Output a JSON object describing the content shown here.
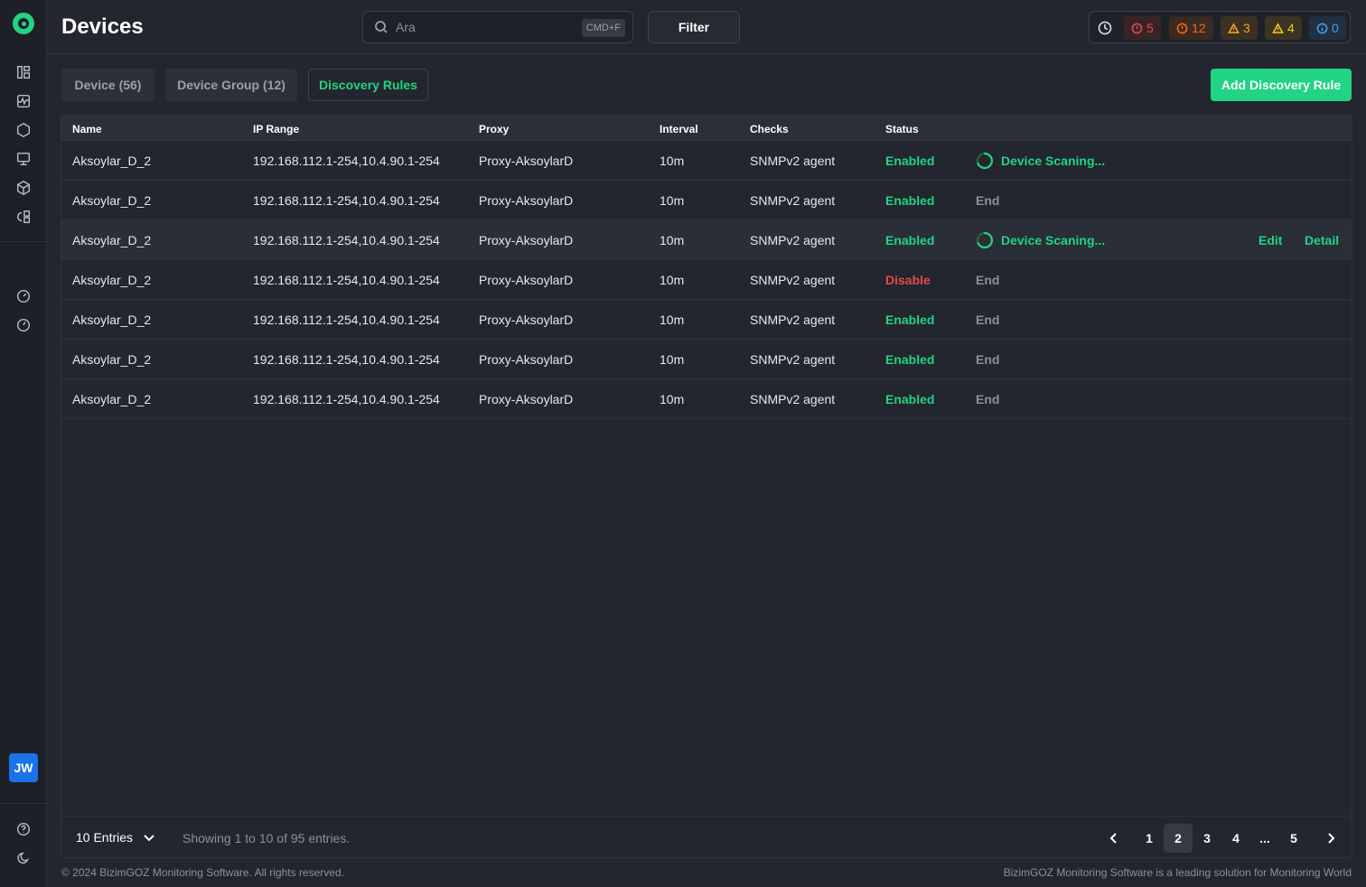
{
  "header": {
    "title": "Devices",
    "search_placeholder": "Ara",
    "search_shortcut": "CMD+F",
    "filter_label": "Filter",
    "alerts": [
      {
        "count": "5",
        "color": "#e5484d",
        "bg": "#3a2327",
        "icon": "error-circle-icon"
      },
      {
        "count": "12",
        "color": "#f76b15",
        "bg": "#3a2a22",
        "icon": "error-circle-icon"
      },
      {
        "count": "3",
        "color": "#f5a524",
        "bg": "#3a3122",
        "icon": "warning-triangle-icon"
      },
      {
        "count": "4",
        "color": "#f5c518",
        "bg": "#3a3522",
        "icon": "warning-triangle-icon"
      },
      {
        "count": "0",
        "color": "#3b9eff",
        "bg": "#22303f",
        "icon": "info-circle-icon"
      }
    ]
  },
  "tabs": [
    {
      "label": "Device (56)",
      "active": false
    },
    {
      "label": "Device Group (12)",
      "active": false
    },
    {
      "label": "Discovery Rules",
      "active": true
    }
  ],
  "add_button_label": "Add Discovery Rule",
  "table": {
    "columns": [
      "Name",
      "IP Range",
      "Proxy",
      "Interval",
      "Checks",
      "Status"
    ],
    "rows": [
      {
        "name": "Aksoylar_D_2",
        "ip": "192.168.112.1-254,10.4.90.1-254",
        "proxy": "Proxy-AksoylarD",
        "interval": "10m",
        "checks": "SNMPv2 agent",
        "status": "Enabled",
        "state": "Device Scaning...",
        "scanning": true
      },
      {
        "name": "Aksoylar_D_2",
        "ip": "192.168.112.1-254,10.4.90.1-254",
        "proxy": "Proxy-AksoylarD",
        "interval": "10m",
        "checks": "SNMPv2 agent",
        "status": "Enabled",
        "state": "End",
        "scanning": false
      },
      {
        "name": "Aksoylar_D_2",
        "ip": "192.168.112.1-254,10.4.90.1-254",
        "proxy": "Proxy-AksoylarD",
        "interval": "10m",
        "checks": "SNMPv2 agent",
        "status": "Enabled",
        "state": "Device Scaning...",
        "scanning": true,
        "edit": "Edit",
        "detail": "Detail"
      },
      {
        "name": "Aksoylar_D_2",
        "ip": "192.168.112.1-254,10.4.90.1-254",
        "proxy": "Proxy-AksoylarD",
        "interval": "10m",
        "checks": "SNMPv2 agent",
        "status": "Disable",
        "state": "End",
        "scanning": false
      },
      {
        "name": "Aksoylar_D_2",
        "ip": "192.168.112.1-254,10.4.90.1-254",
        "proxy": "Proxy-AksoylarD",
        "interval": "10m",
        "checks": "SNMPv2 agent",
        "status": "Enabled",
        "state": "End",
        "scanning": false
      },
      {
        "name": "Aksoylar_D_2",
        "ip": "192.168.112.1-254,10.4.90.1-254",
        "proxy": "Proxy-AksoylarD",
        "interval": "10m",
        "checks": "SNMPv2 agent",
        "status": "Enabled",
        "state": "End",
        "scanning": false
      },
      {
        "name": "Aksoylar_D_2",
        "ip": "192.168.112.1-254,10.4.90.1-254",
        "proxy": "Proxy-AksoylarD",
        "interval": "10m",
        "checks": "SNMPv2 agent",
        "status": "Enabled",
        "state": "End",
        "scanning": false
      }
    ]
  },
  "pagination": {
    "entries_label": "10 Entries",
    "showing_text": "Showing 1 to 10 of 95 entries.",
    "pages": [
      "1",
      "2",
      "3",
      "4",
      "...",
      "5"
    ],
    "current_page": "2"
  },
  "user_initials": "JW",
  "footer": {
    "copyright": "© 2024 BizimGOZ Monitoring Software. All rights reserved.",
    "tagline": "BizimGOZ Monitoring Software is a leading solution for Monitoring World"
  },
  "colors": {
    "accent": "#22d383",
    "danger": "#e5484d",
    "background": "#23262e"
  }
}
